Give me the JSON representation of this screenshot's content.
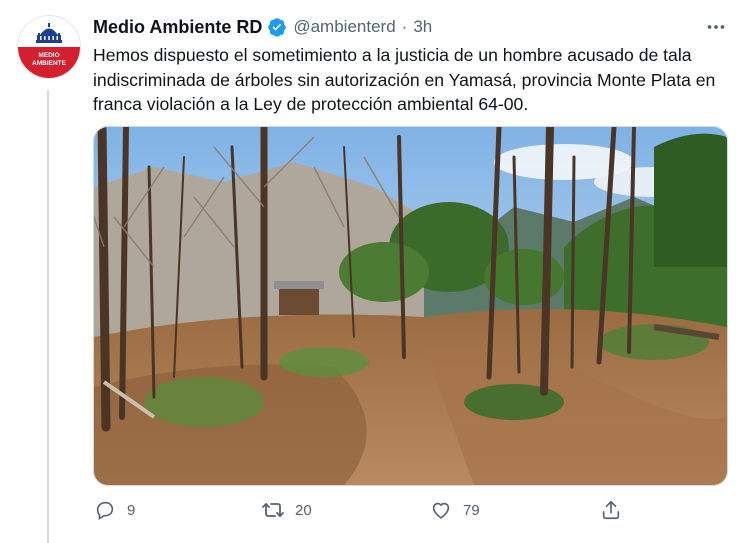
{
  "tweet": {
    "display_name": "Medio Ambiente RD",
    "handle": "@ambienterd",
    "separator": "·",
    "time": "3h",
    "text": "Hemos dispuesto el sometimiento a la justicia de un hombre acusado de tala indiscriminada de árboles sin autorización en Yamasá, provincia Monte Plata en franca violación a la Ley de protección ambiental 64-00.",
    "media_description": "photo-deforested-hillside",
    "more_icon": "more-horizontal-icon",
    "verified_icon": "verified-badge-icon"
  },
  "avatar": {
    "line1": "MEDIO",
    "line2": "AMBIENTE",
    "colors": {
      "top": "#ffffff",
      "bottom": "#d3202f",
      "building": "#1c3f94"
    }
  },
  "actions": {
    "reply": {
      "icon": "reply-icon",
      "count": "9"
    },
    "retweet": {
      "icon": "retweet-icon",
      "count": "20"
    },
    "like": {
      "icon": "heart-icon",
      "count": "79"
    },
    "share": {
      "icon": "share-icon",
      "count": ""
    }
  },
  "colors": {
    "verified": "#1d9bf0",
    "muted": "#536471",
    "text": "#0f1419"
  }
}
